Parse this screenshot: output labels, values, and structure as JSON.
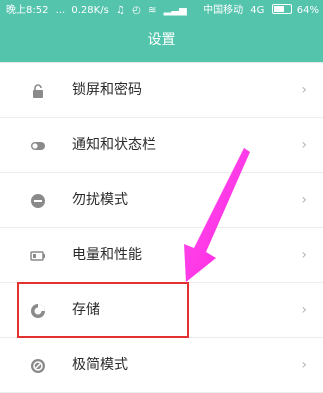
{
  "status_bar": {
    "time": "晚上8:52",
    "dots": "...",
    "speed": "0.28K/s",
    "carrier": "中国移动",
    "network": "4G",
    "battery": "64%"
  },
  "header": {
    "title": "设置"
  },
  "settings": [
    {
      "label": "锁屏和密码",
      "icon": "lock-icon"
    },
    {
      "label": "通知和状态栏",
      "icon": "toggle-icon"
    },
    {
      "label": "勿扰模式",
      "icon": "minus-circle-icon"
    },
    {
      "label": "电量和性能",
      "icon": "battery-icon"
    },
    {
      "label": "存储",
      "icon": "storage-pie-icon"
    },
    {
      "label": "极简模式",
      "icon": "minimal-mode-icon"
    }
  ],
  "chevron": "›",
  "colors": {
    "header": "#55c4ad",
    "highlight": "#e3312f",
    "arrow": "#ff1fe0"
  }
}
